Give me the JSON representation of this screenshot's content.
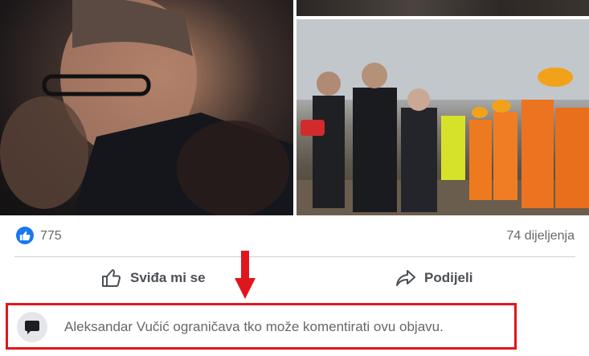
{
  "photos": {
    "left": {
      "description_icon": "photo-image"
    },
    "right_top": {
      "description_icon": "photo-image"
    },
    "right_bottom": {
      "description_icon": "photo-image"
    }
  },
  "reactions": {
    "like_count": "775",
    "share_count": "74 dijeljenja"
  },
  "actions": {
    "like_label": "Sviđa mi se",
    "share_label": "Podijeli"
  },
  "notice": {
    "text": "Aleksandar Vučić ograničava tko može komentirati ovu objavu.",
    "icon": "comment-bubble-icon"
  },
  "colors": {
    "accent": "#1877f2",
    "highlight_border": "#e0161e",
    "arrow": "#e0161e",
    "muted_text": "#65676b"
  }
}
